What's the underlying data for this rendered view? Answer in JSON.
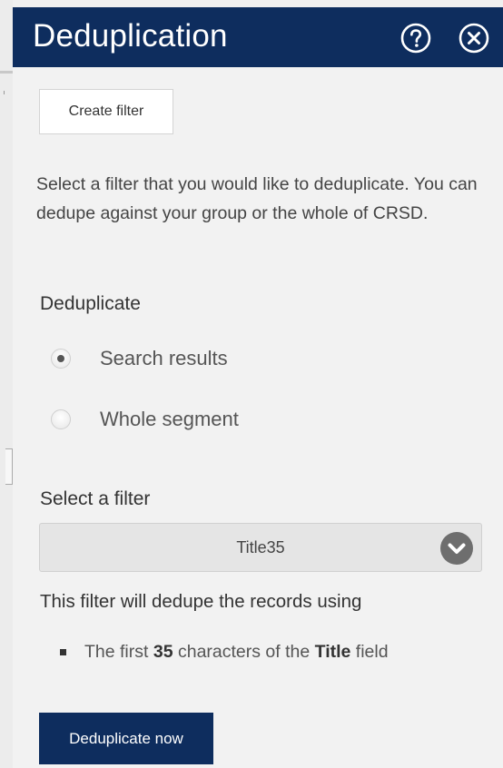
{
  "panel": {
    "title": "Deduplication"
  },
  "toolbar": {
    "create_filter_label": "Create filter"
  },
  "intro_text": "Select a filter that you would like to deduplicate. You can dedupe against your group or the whole of CRSD.",
  "deduplicate": {
    "heading": "Deduplicate",
    "options": [
      {
        "label": "Search results",
        "selected": true
      },
      {
        "label": "Whole segment",
        "selected": false
      }
    ]
  },
  "filter": {
    "heading": "Select a filter",
    "selected_value": "Title35"
  },
  "rule": {
    "heading": "This filter will dedupe the records using",
    "prefix": "The first ",
    "count": "35",
    "middle": " characters of the ",
    "field": "Title",
    "suffix": " field"
  },
  "actions": {
    "deduplicate_now_label": "Deduplicate now"
  },
  "icons": {
    "help": "help-icon",
    "close": "close-icon",
    "dropdown": "chevron-down-icon"
  },
  "colors": {
    "header_bg": "#0e2d5e",
    "primary_button_bg": "#0e2d5e"
  }
}
